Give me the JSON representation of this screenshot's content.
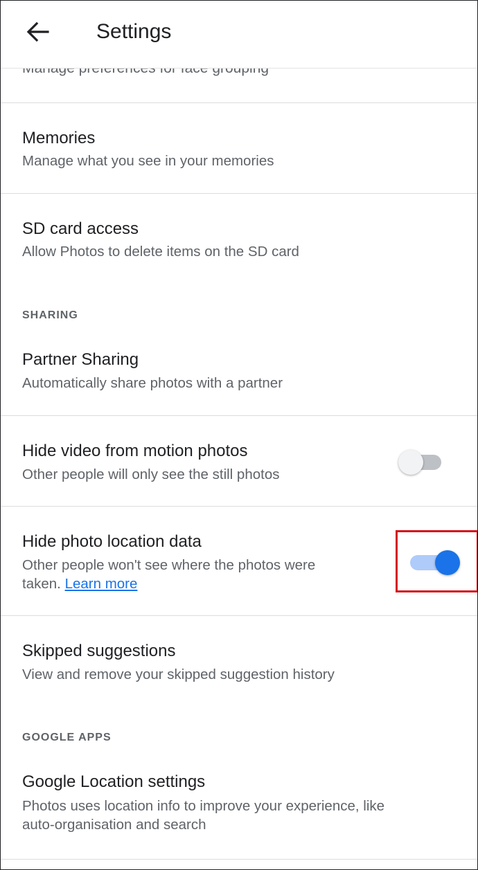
{
  "header": {
    "title": "Settings",
    "back_icon": "arrow-back-icon"
  },
  "partial_item": {
    "subtitle": "Manage preferences for face grouping"
  },
  "items": {
    "memories": {
      "title": "Memories",
      "subtitle": "Manage what you see in your memories"
    },
    "sd_card": {
      "title": "SD card access",
      "subtitle": "Allow Photos to delete items on the SD card"
    },
    "partner_sharing": {
      "title": "Partner Sharing",
      "subtitle": "Automatically share photos with a partner"
    },
    "hide_video": {
      "title": "Hide video from motion photos",
      "subtitle": "Other people will only see the still photos",
      "enabled": false
    },
    "hide_location": {
      "title": "Hide photo location data",
      "subtitle_line1": "Other people won't see where the photos were",
      "subtitle_line2": "taken.",
      "link": "Learn more",
      "enabled": true
    },
    "skipped": {
      "title": "Skipped suggestions",
      "subtitle": "View and remove your skipped suggestion history"
    },
    "location_settings": {
      "title": "Google Location settings",
      "subtitle_line1": "Photos uses location info to improve your experience, like",
      "subtitle_line2": "auto-organisation and search"
    }
  },
  "sections": {
    "sharing": "SHARING",
    "google_apps": "GOOGLE APPS"
  },
  "colors": {
    "accent": "#1a73e8",
    "highlight_border": "#d3131a"
  }
}
